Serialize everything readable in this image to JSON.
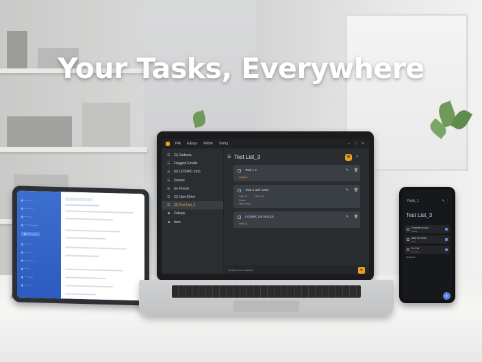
{
  "headline": "Your Tasks, Everywhere",
  "colors": {
    "accent": "#e8a020",
    "tablet_primary": "#3c6fd0",
    "phone_accent": "#5b7fe0",
    "desktop_bg": "#2a2d30"
  },
  "desktop_app": {
    "menu": [
      "Plik",
      "Edycja",
      "Widok",
      "Sortuj"
    ],
    "window_controls": [
      "–",
      "⤢",
      "✕"
    ],
    "sidebar": [
      {
        "icon": "list-icon",
        "label": "(1) Zadania"
      },
      {
        "icon": "list-icon",
        "label": "Flagged Emails"
      },
      {
        "icon": "list-icon",
        "label": "(0) COSMIC todo"
      },
      {
        "icon": "list-icon",
        "label": "Domek"
      },
      {
        "icon": "list-icon",
        "label": "do Firanie"
      },
      {
        "icon": "list-icon",
        "label": "(1) OpenDrive"
      },
      {
        "icon": "list-icon",
        "label": "(3) Test List_3"
      },
      {
        "icon": "person-icon",
        "label": "Zakupy"
      },
      {
        "icon": "person-icon",
        "label": "dom"
      }
    ],
    "active_list_index": 6,
    "title": "Test List_3",
    "tasks": [
      {
        "name": "Task 1 2",
        "date": "Aug 01",
        "date2": "",
        "note": ""
      },
      {
        "name": "Task 2 with notes",
        "date": "Sep 01",
        "date2": "Sep 01",
        "note": "Notes\nWith notes"
      },
      {
        "name": "COSMIC DE RULES",
        "date": "Sep 01",
        "date2": "",
        "note": ""
      }
    ],
    "input_placeholder": "Dodaj nowe zadanie"
  },
  "phone": {
    "header": "Rolki_1",
    "title": "Test List_3",
    "tasks": [
      {
        "name": "Example record",
        "meta": "Dzisiaj",
        "overdue": false
      },
      {
        "name": "ABC for recall",
        "meta": "Jutro",
        "overdue": false
      },
      {
        "name": "Do Full",
        "meta": "Overdue",
        "overdue": true
      }
    ],
    "section": "Zrobione",
    "fab": "+"
  }
}
